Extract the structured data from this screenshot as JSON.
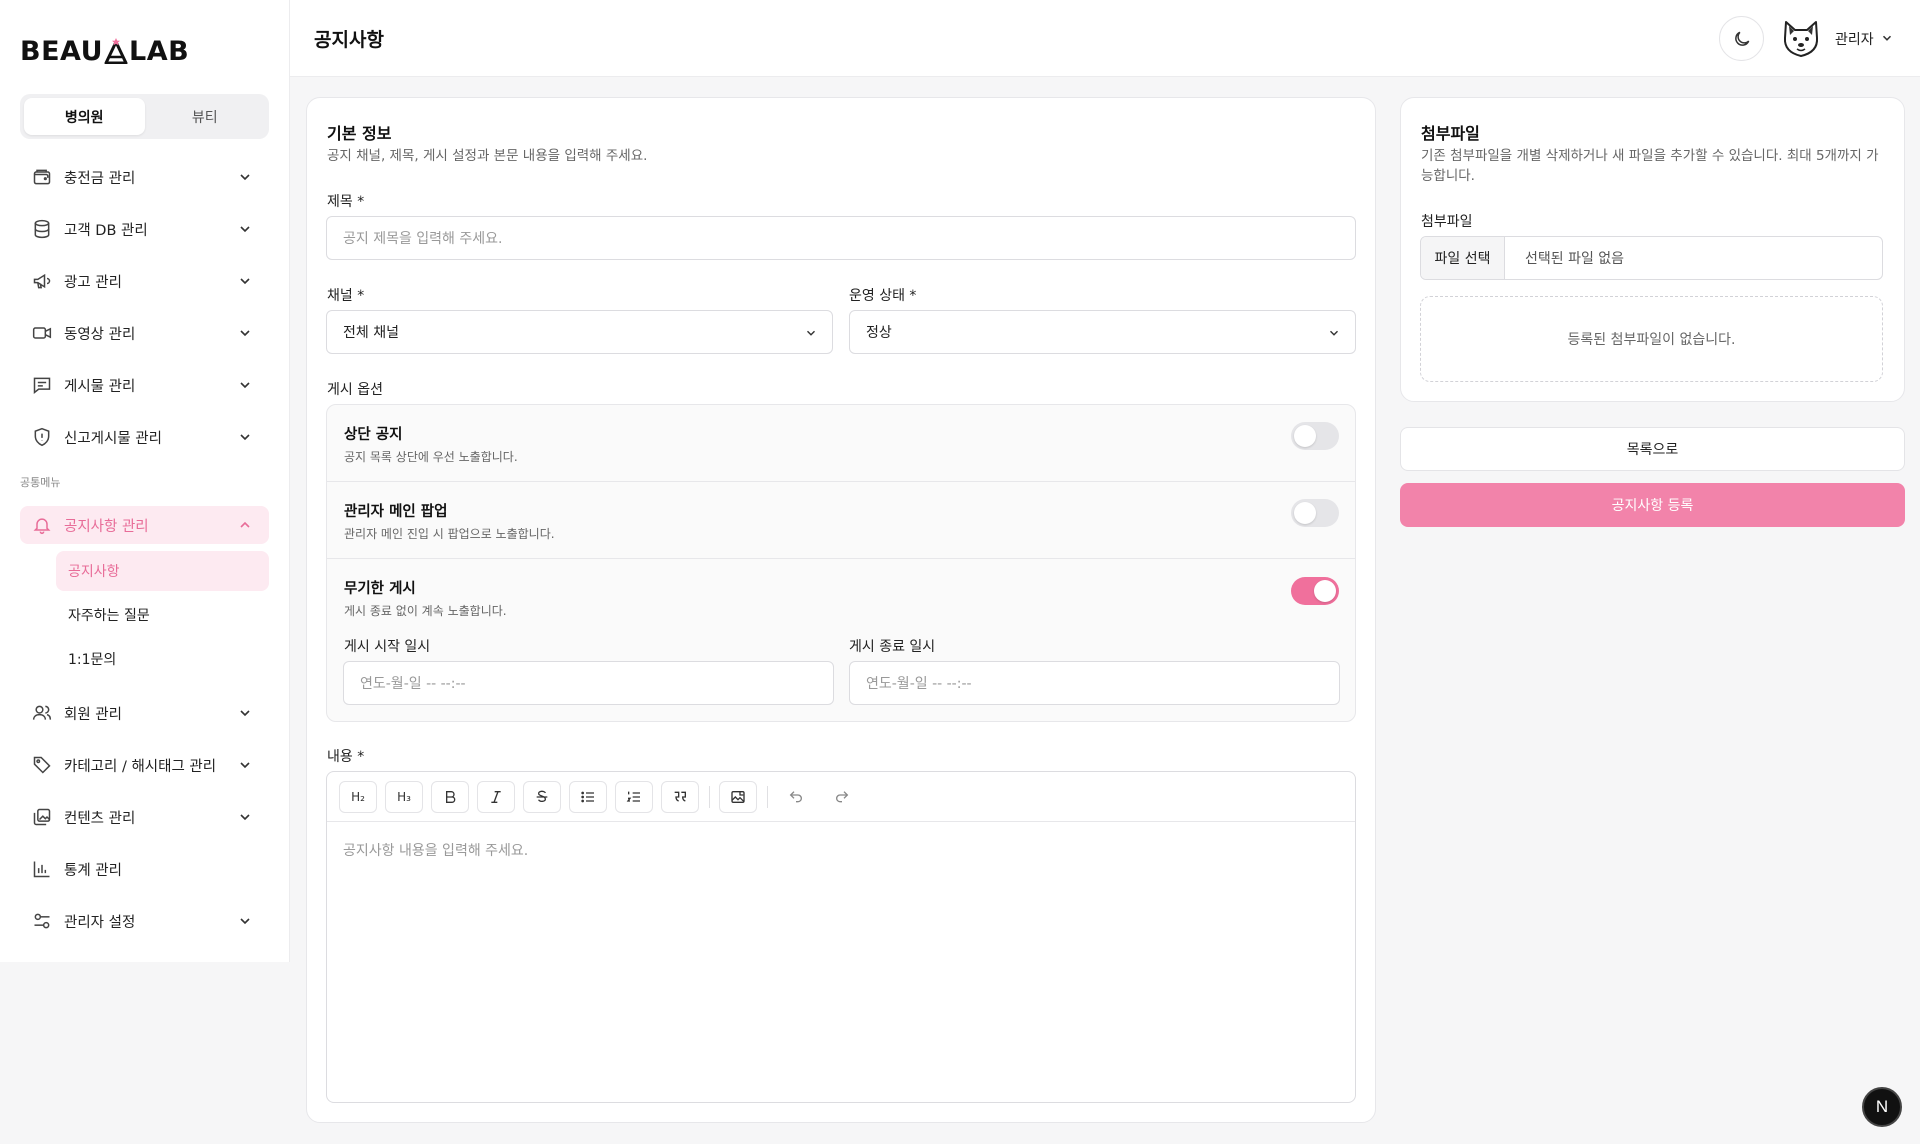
{
  "brand": {
    "logo_left": "BEAU",
    "logo_right": "LAB",
    "accent_color": "#f283aa"
  },
  "sidebar": {
    "segments": [
      "병의원",
      "뷰티"
    ],
    "active_segment": "병의원",
    "items": [
      {
        "label": "충전금 관리",
        "icon": "wallet-icon"
      },
      {
        "label": "고객 DB 관리",
        "icon": "database-icon"
      },
      {
        "label": "광고 관리",
        "icon": "megaphone-icon"
      },
      {
        "label": "동영상 관리",
        "icon": "video-icon"
      },
      {
        "label": "게시물 관리",
        "icon": "message-square-icon"
      },
      {
        "label": "신고게시물 관리",
        "icon": "shield-alert-icon"
      }
    ],
    "section_label": "공통메뉴",
    "notice": {
      "label": "공지사항 관리",
      "icon": "bell-icon"
    },
    "sub_items": [
      "공지사항",
      "자주하는 질문",
      "1:1문의"
    ],
    "items2": [
      {
        "label": "회원 관리",
        "icon": "users-icon"
      },
      {
        "label": "카테고리 / 해시태그 관리",
        "icon": "tag-icon"
      },
      {
        "label": "컨텐츠 관리",
        "icon": "images-icon"
      },
      {
        "label": "통계 관리",
        "icon": "bar-chart-icon"
      },
      {
        "label": "관리자 설정",
        "icon": "settings-sliders-icon"
      }
    ]
  },
  "header": {
    "title": "공지사항",
    "user_name": "관리자"
  },
  "basic": {
    "title": "기본 정보",
    "desc": "공지 채널, 제목, 게시 설정과 본문 내용을 입력해 주세요.",
    "subject_label": "제목 *",
    "subject_placeholder": "공지 제목을 입력해 주세요.",
    "channel_label": "채널 *",
    "channel_value": "전체 채널",
    "status_label": "운영 상태 *",
    "status_value": "정상",
    "options_label": "게시 옵션",
    "options": [
      {
        "title": "상단 공지",
        "desc": "공지 목록 상단에 우선 노출합니다.",
        "on": false
      },
      {
        "title": "관리자 메인 팝업",
        "desc": "관리자 메인 진입 시 팝업으로 노출합니다.",
        "on": false
      },
      {
        "title": "무기한 게시",
        "desc": "게시 종료 없이 계속 노출합니다.",
        "on": true
      }
    ],
    "start_label": "게시 시작 일시",
    "start_placeholder": "연도-월-일 -- --:--",
    "end_label": "게시 종료 일시",
    "end_placeholder": "연도-월-일 -- --:--",
    "content_label": "내용 *",
    "content_placeholder": "공지사항 내용을 입력해 주세요.",
    "toolbar": {
      "h2": "H₂",
      "h3": "H₃"
    }
  },
  "attachment": {
    "title": "첨부파일",
    "desc": "기존 첨부파일을 개별 삭제하거나 새 파일을 추가할 수 있습니다. 최대 5개까지 가능합니다.",
    "field_label": "첨부파일",
    "choose_button": "파일 선택",
    "no_file": "선택된 파일 없음",
    "empty": "등록된 첨부파일이 없습니다."
  },
  "actions": {
    "list": "목록으로",
    "submit": "공지사항 등록"
  },
  "badge": "N"
}
